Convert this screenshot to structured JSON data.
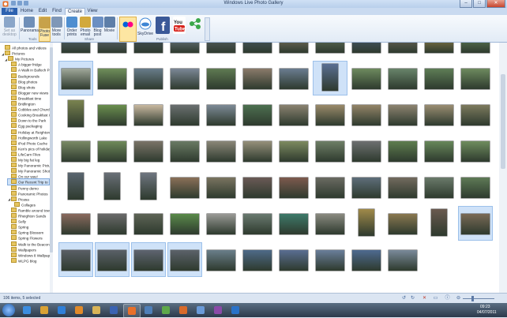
{
  "window": {
    "title": "Windows Live Photo Gallery",
    "controls": {
      "minimize": "–",
      "maximize": "□",
      "close": "✕"
    }
  },
  "tabs": [
    {
      "label": "File",
      "state": "file"
    },
    {
      "label": "Home",
      "state": ""
    },
    {
      "label": "Edit",
      "state": ""
    },
    {
      "label": "Find",
      "state": ""
    },
    {
      "label": "Create",
      "state": "active"
    },
    {
      "label": "View",
      "state": ""
    }
  ],
  "ribbon": {
    "buttons": [
      {
        "label": "Set as desktop",
        "icon": "desktop-icon",
        "color": "#8aa6c9",
        "state": "disabled"
      },
      {
        "label": "Panorama",
        "icon": "panorama-icon",
        "color": "#6f8fb8",
        "state": ""
      },
      {
        "label": "Photo Fuse",
        "icon": "photo-fuse-icon",
        "color": "#c7a24a",
        "state": "sel"
      },
      {
        "label": "More tools",
        "icon": "more-tools-icon",
        "color": "#7f97b7",
        "state": ""
      },
      {
        "label": "Order prints",
        "icon": "order-prints-icon",
        "color": "#4e8ed0",
        "state": ""
      },
      {
        "label": "Photo email",
        "icon": "photo-email-icon",
        "color": "#d2a93c",
        "state": ""
      },
      {
        "label": "Blog post",
        "icon": "blog-post-icon",
        "color": "#6b8fc2",
        "state": ""
      },
      {
        "label": "Movie",
        "icon": "movie-icon",
        "color": "#5d7ea8",
        "state": ""
      },
      {
        "label": "",
        "icon": "flickr-icon",
        "color": "#f5f5f5",
        "state": "sel"
      },
      {
        "label": "SkyDrive",
        "icon": "skydrive-icon",
        "color": "#3f86d4",
        "state": ""
      },
      {
        "label": "",
        "icon": "facebook-icon",
        "color": "#3b5998",
        "state": ""
      },
      {
        "label": "",
        "icon": "youtube-icon",
        "color": "#d8231b",
        "state": ""
      },
      {
        "label": "",
        "icon": "network-icon",
        "color": "#3ba84a",
        "state": ""
      }
    ],
    "groups": [
      {
        "label": "Tools"
      },
      {
        "label": "Share"
      },
      {
        "label": "Publish"
      }
    ]
  },
  "sidebar": {
    "items": [
      {
        "label": "All photos and videos",
        "level": 0,
        "expand": "",
        "selected": false
      },
      {
        "label": "Pictures",
        "level": 0,
        "expand": "◢",
        "selected": false
      },
      {
        "label": "My Pictures",
        "level": 1,
        "expand": "◢",
        "selected": false
      },
      {
        "label": "A bigger fridge",
        "level": 2,
        "expand": "",
        "selected": false
      },
      {
        "label": "A Walk in Balloch Park",
        "level": 2,
        "expand": "",
        "selected": false
      },
      {
        "label": "Backgrounds",
        "level": 2,
        "expand": "",
        "selected": false
      },
      {
        "label": "Blog photos",
        "level": 2,
        "expand": "",
        "selected": false
      },
      {
        "label": "Blog shots",
        "level": 2,
        "expand": "",
        "selected": false
      },
      {
        "label": "Blogger new views",
        "level": 2,
        "expand": "",
        "selected": false
      },
      {
        "label": "Breakfast time",
        "level": 2,
        "expand": "",
        "selected": false
      },
      {
        "label": "Bridlington",
        "level": 2,
        "expand": "",
        "selected": false
      },
      {
        "label": "Cobbles and Churches",
        "level": 2,
        "expand": "",
        "selected": false
      },
      {
        "label": "Cooking Breakfast in 20",
        "level": 2,
        "expand": "",
        "selected": false
      },
      {
        "label": "Down to the Park",
        "level": 2,
        "expand": "",
        "selected": false
      },
      {
        "label": "Egg packaging",
        "level": 2,
        "expand": "",
        "selected": false
      },
      {
        "label": "Holiday at Reighton Se",
        "level": 2,
        "expand": "",
        "selected": false
      },
      {
        "label": "Hollingworth Lake",
        "level": 2,
        "expand": "",
        "selected": false
      },
      {
        "label": "iPod Photo Cache",
        "level": 2,
        "expand": "",
        "selected": false
      },
      {
        "label": "Ken's pics of holiday",
        "level": 2,
        "expand": "",
        "selected": false
      },
      {
        "label": "LifeCam Files",
        "level": 2,
        "expand": "",
        "selected": false
      },
      {
        "label": "My big fat leg",
        "level": 2,
        "expand": "",
        "selected": false
      },
      {
        "label": "My Panoramic Pictures",
        "level": 2,
        "expand": "",
        "selected": false
      },
      {
        "label": "My Panoramic Shots",
        "level": 2,
        "expand": "",
        "selected": false
      },
      {
        "label": "On our way!",
        "level": 2,
        "expand": "",
        "selected": false
      },
      {
        "label": "Our Recent Trip to York",
        "level": 2,
        "expand": "",
        "selected": true
      },
      {
        "label": "Penny demo",
        "level": 2,
        "expand": "",
        "selected": false
      },
      {
        "label": "Panoramic Photos",
        "level": 2,
        "expand": "",
        "selected": false
      },
      {
        "label": "Picasa",
        "level": 2,
        "expand": "◢",
        "selected": false
      },
      {
        "label": "Collages",
        "level": 3,
        "expand": "",
        "selected": false
      },
      {
        "label": "Ramble around town",
        "level": 2,
        "expand": "",
        "selected": false
      },
      {
        "label": "Rheighton Sands",
        "level": 2,
        "expand": "",
        "selected": false
      },
      {
        "label": "Selly",
        "level": 2,
        "expand": "",
        "selected": false
      },
      {
        "label": "Spring",
        "level": 2,
        "expand": "",
        "selected": false
      },
      {
        "label": "Spring Blossom",
        "level": 2,
        "expand": "",
        "selected": false
      },
      {
        "label": "Spring Flowers",
        "level": 2,
        "expand": "",
        "selected": false
      },
      {
        "label": "Walk to the Beacon",
        "level": 2,
        "expand": "",
        "selected": false
      },
      {
        "label": "Wallpapers",
        "level": 2,
        "expand": "",
        "selected": false
      },
      {
        "label": "Windows 8 Wallpapers",
        "level": 2,
        "expand": "",
        "selected": false
      },
      {
        "label": "WLPG blog",
        "level": 2,
        "expand": "",
        "selected": false
      }
    ]
  },
  "gallery": {
    "rows": [
      {
        "items": [
          {
            "o": "l",
            "c": "#5d6b7a",
            "s": false
          },
          {
            "o": "l",
            "c": "#6a7080",
            "s": false
          },
          {
            "o": "l",
            "c": "#4a5566",
            "s": false
          },
          {
            "o": "l",
            "c": "#7a8696",
            "s": false
          },
          {
            "o": "l",
            "c": "#656c73",
            "s": false
          },
          {
            "o": "l",
            "c": "#50606e",
            "s": false
          },
          {
            "o": "l",
            "c": "#8a7d6a",
            "s": false
          },
          {
            "o": "l",
            "c": "#6d7c66",
            "s": false
          },
          {
            "o": "l",
            "c": "#4d5f78",
            "s": false
          },
          {
            "o": "l",
            "c": "#7a7066",
            "s": false
          },
          {
            "o": "l",
            "c": "#a08a50",
            "s": false
          },
          {
            "o": "l",
            "c": "#6a8a60",
            "s": false
          }
        ]
      },
      {
        "items": [
          {
            "o": "l",
            "c": "#a0a89a",
            "s": true
          },
          {
            "o": "l",
            "c": "#6f8f5a",
            "s": false
          },
          {
            "o": "l",
            "c": "#687c8a",
            "s": false
          },
          {
            "o": "l",
            "c": "#7b8796",
            "s": false
          },
          {
            "o": "l",
            "c": "#5f7a52",
            "s": false
          },
          {
            "o": "l",
            "c": "#8a7a6a",
            "s": false
          },
          {
            "o": "l",
            "c": "#6a7c90",
            "s": false
          },
          {
            "o": "p",
            "c": "#5a6f92",
            "s": true
          },
          {
            "o": "l",
            "c": "#6d8a5e",
            "s": false
          },
          {
            "o": "l",
            "c": "#68846a",
            "s": false
          },
          {
            "o": "l",
            "c": "#5e7d56",
            "s": false
          },
          {
            "o": "l",
            "c": "#6d8a5e",
            "s": false
          }
        ]
      },
      {
        "items": [
          {
            "o": "p",
            "c": "#7a8350",
            "s": false
          },
          {
            "o": "l",
            "c": "#6a8e4e",
            "s": false
          },
          {
            "o": "l",
            "c": "#c8b8a0",
            "s": false
          },
          {
            "o": "l",
            "c": "#6a6f70",
            "s": false
          },
          {
            "o": "l",
            "c": "#7d8a96",
            "s": false
          },
          {
            "o": "l",
            "c": "#4d7050",
            "s": false
          },
          {
            "o": "l",
            "c": "#8a8270",
            "s": false
          },
          {
            "o": "l",
            "c": "#9a8a6a",
            "s": false
          },
          {
            "o": "l",
            "c": "#938468",
            "s": false
          },
          {
            "o": "l",
            "c": "#8d8370",
            "s": false
          },
          {
            "o": "l",
            "c": "#9a8d72",
            "s": false
          },
          {
            "o": "l",
            "c": "#7d7a5e",
            "s": false
          }
        ]
      },
      {
        "items": [
          {
            "o": "l",
            "c": "#7a8a66",
            "s": false
          },
          {
            "o": "l",
            "c": "#6f8a5a",
            "s": false
          },
          {
            "o": "l",
            "c": "#7a7468",
            "s": false
          },
          {
            "o": "l",
            "c": "#6a7a64",
            "s": false
          },
          {
            "o": "l",
            "c": "#8a8678",
            "s": false
          },
          {
            "o": "l",
            "c": "#96907a",
            "s": false
          },
          {
            "o": "l",
            "c": "#7d8a60",
            "s": false
          },
          {
            "o": "l",
            "c": "#6e7e66",
            "s": false
          },
          {
            "o": "l",
            "c": "#6d6f70",
            "s": false
          },
          {
            "o": "l",
            "c": "#5e7d4e",
            "s": false
          },
          {
            "o": "l",
            "c": "#67875a",
            "s": false
          },
          {
            "o": "l",
            "c": "#6f8d5e",
            "s": false
          }
        ]
      },
      {
        "items": [
          {
            "o": "p",
            "c": "#5a6670",
            "s": false
          },
          {
            "o": "p",
            "c": "#6a7078",
            "s": false
          },
          {
            "o": "p",
            "c": "#6f7680",
            "s": false
          },
          {
            "o": "l",
            "c": "#8a7058",
            "s": false
          },
          {
            "o": "l",
            "c": "#7a7460",
            "s": false
          },
          {
            "o": "l",
            "c": "#6a5a56",
            "s": false
          },
          {
            "o": "l",
            "c": "#7d5a4e",
            "s": false
          },
          {
            "o": "l",
            "c": "#6a6a62",
            "s": false
          },
          {
            "o": "l",
            "c": "#5e6e7a",
            "s": false
          },
          {
            "o": "l",
            "c": "#726a5e",
            "s": false
          },
          {
            "o": "l",
            "c": "#6a7a6a",
            "s": false
          },
          {
            "o": "l",
            "c": "#5e7a56",
            "s": false
          }
        ]
      },
      {
        "items": [
          {
            "o": "l",
            "c": "#8a6a5e",
            "s": false
          },
          {
            "o": "l",
            "c": "#6a6a6a",
            "s": false
          },
          {
            "o": "l",
            "c": "#5e6456",
            "s": false
          },
          {
            "o": "l",
            "c": "#5a8a4a",
            "s": false
          },
          {
            "o": "l",
            "c": "#9a9a96",
            "s": false
          },
          {
            "o": "l",
            "c": "#6a7a70",
            "s": false
          },
          {
            "o": "l",
            "c": "#3e7a6a",
            "s": false
          },
          {
            "o": "l",
            "c": "#8a8a80",
            "s": false
          },
          {
            "o": "p",
            "c": "#a08a4a",
            "s": false
          },
          {
            "o": "l",
            "c": "#8a7850",
            "s": false
          },
          {
            "o": "p",
            "c": "#6a5a50",
            "s": false
          },
          {
            "o": "l",
            "c": "#7a6a56",
            "s": true
          }
        ]
      },
      {
        "items": [
          {
            "o": "l",
            "c": "#5a5f66",
            "s": true
          },
          {
            "o": "l",
            "c": "#5a6068",
            "s": true
          },
          {
            "o": "l",
            "c": "#5e6470",
            "s": true
          },
          {
            "o": "l",
            "c": "#5c626a",
            "s": true
          },
          {
            "o": "l",
            "c": "#6a7e8a",
            "s": false
          },
          {
            "o": "l",
            "c": "#4e6a88",
            "s": false
          },
          {
            "o": "l",
            "c": "#5a6e92",
            "s": false
          },
          {
            "o": "l",
            "c": "#6a7e9a",
            "s": false
          },
          {
            "o": "l",
            "c": "#4e6a90",
            "s": false
          },
          {
            "o": "l",
            "c": "#7a8a9a",
            "s": false
          }
        ]
      }
    ]
  },
  "status": {
    "text": "106 items, 5 selected",
    "icons": [
      "rotate-left-icon",
      "rotate-right-icon",
      "delete-icon",
      "slideshow-icon",
      "info-icon",
      "zoom-out-icon"
    ]
  },
  "taskbar": {
    "items": [
      {
        "icon": "ie-icon",
        "open": false,
        "color": "#3c8de0"
      },
      {
        "icon": "chrome-icon",
        "open": false,
        "color": "#d9a235"
      },
      {
        "icon": "ie-icon-2",
        "open": false,
        "color": "#2f7fd8"
      },
      {
        "icon": "media-player-icon",
        "open": false,
        "color": "#e08a2a"
      },
      {
        "icon": "explorer-icon",
        "open": false,
        "color": "#d8b458"
      },
      {
        "icon": "word-icon",
        "open": false,
        "color": "#3a63b2"
      },
      {
        "icon": "photo-gallery-icon",
        "open": true,
        "color": "#e8702a"
      },
      {
        "icon": "live-writer-icon",
        "open": false,
        "color": "#4f7fb8"
      },
      {
        "icon": "messenger-icon",
        "open": false,
        "color": "#5ea84a"
      },
      {
        "icon": "firefox-icon",
        "open": false,
        "color": "#d86a2a"
      },
      {
        "icon": "paint-icon",
        "open": false,
        "color": "#6a9ad8"
      },
      {
        "icon": "onenote-icon",
        "open": false,
        "color": "#8a4aa8"
      },
      {
        "icon": "outlook-icon",
        "open": false,
        "color": "#2a72c8"
      }
    ],
    "clock_time": "09:23",
    "clock_date": "04/07/2011"
  }
}
